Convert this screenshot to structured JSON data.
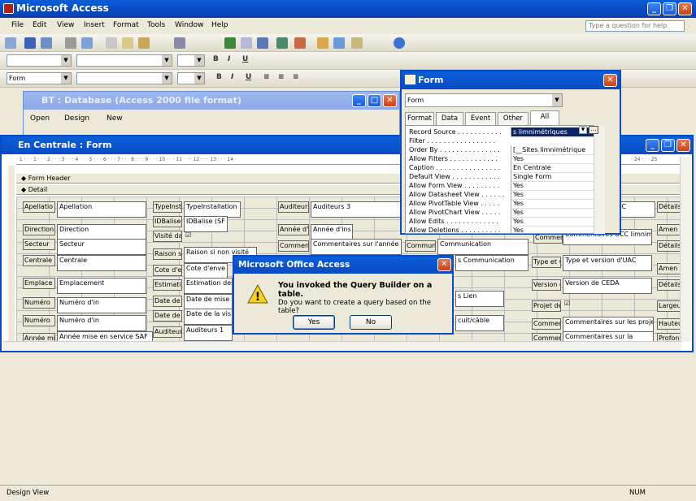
{
  "app": {
    "title": "Microsoft Access",
    "menu": [
      "File",
      "Edit",
      "View",
      "Insert",
      "Format",
      "Tools",
      "Window",
      "Help"
    ],
    "help_placeholder": "Type a question for help",
    "object_combo": "Form"
  },
  "db_window": {
    "title": "BT : Database (Access 2000 file format)",
    "buttons": [
      "Open",
      "Design",
      "New"
    ]
  },
  "form_window": {
    "title": "En Centrale : Form",
    "ruler": "· 1 · · · 1 · · · 2 · · · 3 · · · 4 · · · 5 · · · 6 · · · 7 · · · 8 · · · 9 · · · 10 · · · 11 · · · 12 · · · 13 · · · 14 ·",
    "ruler_right": "· 24 · · · 25 ·",
    "sections": {
      "header": "Form Header",
      "detail": "Detail"
    },
    "fields": [
      {
        "label": "Apellatio",
        "value": "Apellation"
      },
      {
        "label": "Direction",
        "value": "Direction"
      },
      {
        "label": "Secteur",
        "value": "Secteur"
      },
      {
        "label": "Centrale",
        "value": "Centrale"
      },
      {
        "label": "Emplace",
        "value": "Emplacement"
      },
      {
        "label": "Numéro",
        "value": "Numéro d'in"
      },
      {
        "label": "Numéro",
        "value": "Numéro d'in"
      },
      {
        "label": "Année mi",
        "value": "Année mise en service SAF"
      },
      {
        "label": "TypeInst",
        "value": "TypeInstallation"
      },
      {
        "label": "IDBalise",
        "value": "IDBalise (SF"
      },
      {
        "label": "Visité dar",
        "value": "☑"
      },
      {
        "label": "Raison si",
        "value": "Raison si non visité"
      },
      {
        "label": "Cote d'er",
        "value": "Cote d'enve"
      },
      {
        "label": "Estimatio",
        "value": "Estimation des"
      },
      {
        "label": "Date de",
        "value": "Date de mise"
      },
      {
        "label": "Date de l",
        "value": "Date de la vis"
      },
      {
        "label": "Auditeurs",
        "value": "Auditeurs 1"
      },
      {
        "label": "Auditeurs",
        "value": "Auditeurs 3"
      },
      {
        "label": "Année d'",
        "value": "Année d'ins"
      },
      {
        "label": "Comment",
        "value": "Commentaires sur l'année d"
      },
      {
        "label": "Communi",
        "value": "Communication"
      },
      {
        "label": "",
        "value": "s Communication"
      },
      {
        "label": "",
        "value": "s Lien"
      },
      {
        "label": "",
        "value": "cuit/câble"
      },
      {
        "label": "Comment",
        "value": "Commentaires UCC limnimètre"
      },
      {
        "label": "Type et v",
        "value": "Type et version d'UAC"
      },
      {
        "label": "Version c",
        "value": "Version de CEDA"
      },
      {
        "label": "Projet de",
        "value": "☑"
      },
      {
        "label": "Commen",
        "value": "Commentaires sur les projet"
      },
      {
        "label": "Commen",
        "value": "Commentaires sur la"
      },
      {
        "label": "",
        "value": "CC"
      },
      {
        "label": "Détails",
        "value": ""
      },
      {
        "label": "Amen",
        "value": ""
      },
      {
        "label": "Détails",
        "value": ""
      },
      {
        "label": "Amen",
        "value": ""
      },
      {
        "label": "Détails",
        "value": ""
      },
      {
        "label": "Largeu",
        "value": ""
      },
      {
        "label": "Hauteu",
        "value": ""
      },
      {
        "label": "Profon",
        "value": ""
      }
    ]
  },
  "property_sheet": {
    "title": "Form",
    "selector": "Form",
    "tabs": [
      "Format",
      "Data",
      "Event",
      "Other",
      "All"
    ],
    "active_tab": "All",
    "rows": [
      {
        "name": "Record Source . . . . . . . . . . .",
        "value": "s limnimétriques"
      },
      {
        "name": "Filter . . . . . . . . . . . . . . . . .",
        "value": ""
      },
      {
        "name": "Order By . . . . . . . . . . . . . . .",
        "value": "[__Sites limnimétrique"
      },
      {
        "name": "Allow Filters . . . . . . . . . . . .",
        "value": "Yes"
      },
      {
        "name": "Caption . . . . . . . . . . . . . . . .",
        "value": "En Centrale"
      },
      {
        "name": "Default View . . . . . . . . . . . .",
        "value": "Single Form"
      },
      {
        "name": "Allow Form View . . . . . . . . .",
        "value": "Yes"
      },
      {
        "name": "Allow Datasheet View . . . . . .",
        "value": "Yes"
      },
      {
        "name": "Allow PivotTable View . . . . .",
        "value": "Yes"
      },
      {
        "name": "Allow PivotChart View . . . . .",
        "value": "Yes"
      },
      {
        "name": "Allow Edits . . . . . . . . . . . . .",
        "value": "Yes"
      },
      {
        "name": "Allow Deletions . . . . . . . . . .",
        "value": "Yes"
      }
    ]
  },
  "msgbox": {
    "title": "Microsoft Office Access",
    "heading": "You invoked the Query Builder on a table.",
    "body": "Do you want to create a query based on the table?",
    "yes": "Yes",
    "no": "No"
  },
  "status": {
    "left": "Design View",
    "num": "NUM"
  }
}
